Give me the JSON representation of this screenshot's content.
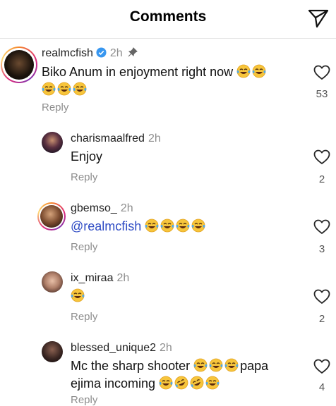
{
  "header": {
    "title": "Comments"
  },
  "comments": [
    {
      "username": "realmcfish",
      "time": "2h",
      "line1": "Biko Anum in enjoyment right now",
      "reply": "Reply",
      "likes": "53"
    },
    {
      "username": "charismaalfred",
      "time": "2h",
      "text": "Enjoy",
      "reply": "Reply",
      "likes": "2"
    },
    {
      "username": "gbemso_",
      "time": "2h",
      "mention": "@realmcfish",
      "reply": "Reply",
      "likes": "3"
    },
    {
      "username": "ix_miraa",
      "time": "2h",
      "reply": "Reply",
      "likes": "2"
    },
    {
      "username": "blessed_unique2",
      "time": "2h",
      "line1a": "Mc the sharp shooter",
      "line1b": "papa",
      "line2": "ejima incoming",
      "reply": "Reply",
      "likes": "4"
    }
  ]
}
